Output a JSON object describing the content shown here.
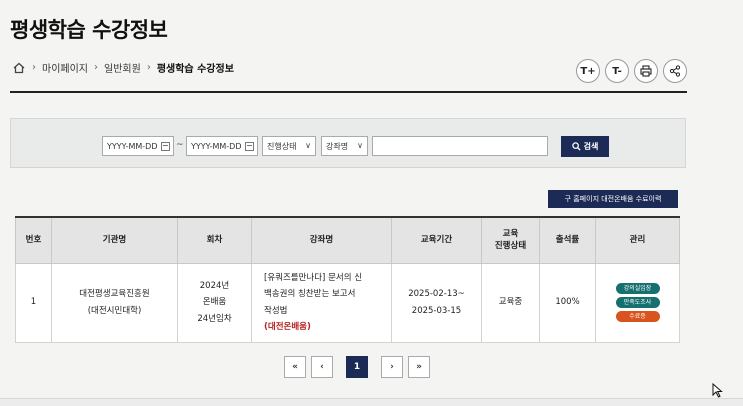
{
  "page": {
    "title": "평생학습 수강정보"
  },
  "breadcrumb": {
    "items": [
      "마이페이지",
      "일반회원",
      "평생학습 수강정보"
    ]
  },
  "tools": {
    "font_up": "T+",
    "font_down": "T-"
  },
  "search": {
    "date_from_placeholder": "YYYY-MM-DD",
    "date_to_placeholder": "YYYY-MM-DD",
    "tilde": "~",
    "status_select": "진행상태",
    "course_select": "강좌명",
    "keyword_value": "",
    "button_label": "검색"
  },
  "history_button": "구 홈페이지 대전온배움 수료이력",
  "table": {
    "headers": {
      "no": "번호",
      "org": "기관명",
      "round": "회차",
      "course": "강좌명",
      "period": "교육기간",
      "status_1": "교육",
      "status_2": "진행상태",
      "attendance": "출석률",
      "manage": "관리"
    },
    "rows": [
      {
        "no": "1",
        "org_1": "대전평생교육진흥원",
        "org_2": "(대전시민대학)",
        "round_1": "2024년",
        "round_2": "온배움",
        "round_3": "24년임차",
        "course_1": "[유쿼즈를만나다] 문서의 신",
        "course_2": "백송권의 칭찬받는 보고서",
        "course_3": "작성법",
        "course_tag": "(대전온배움)",
        "period_start": "2025-02-13~",
        "period_end": "2025-03-15",
        "status": "교육중",
        "attendance": "100%",
        "actions": [
          "강의실입장",
          "만족도조사",
          "수료증"
        ]
      }
    ]
  },
  "pagination": {
    "first": "«",
    "prev": "‹",
    "current": "1",
    "next": "›",
    "last": "»"
  },
  "colors": {
    "navy": "#1c2b55",
    "teal": "#16706f",
    "orange": "#d9531e",
    "red_tag": "#b52020"
  }
}
